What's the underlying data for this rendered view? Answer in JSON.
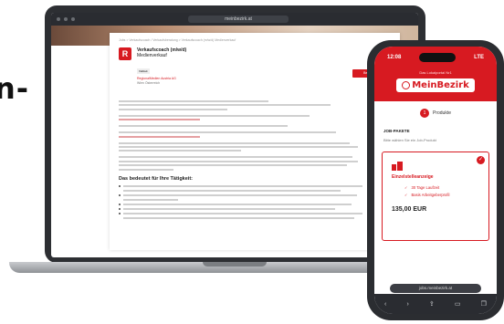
{
  "left_heading": "n-",
  "laptop": {
    "url": "meinbezirk.at",
    "breadcrumb": "Jobs > Verkaufscoach / Verkaufsberatung > Verkaufscoach (m/w/d) Medienverkauf",
    "job_title": "Verkaufscoach (m/w/d)",
    "job_subtitle": "Medienverkauf",
    "job_tag": "Vollzeit",
    "company": "RegionalMedien Austria AG",
    "location": "Wien Österreich",
    "section_heading": "Das bedeutet für Ihre Tätigkeit:",
    "apply_label": "Bewerben"
  },
  "phone": {
    "time": "12:08",
    "signal": "LTE",
    "tagline": "Das Lokalportal Nr1",
    "brand": "MeinBezirk",
    "step_number": "1",
    "step_label": "Produkte",
    "section_title": "JOB-PAKETE",
    "section_sub": "Bitte wählen Sie ein Job-Produkt",
    "product": {
      "name": "Einzelstelleanzeige",
      "features": [
        "30 Tage Laufzeit",
        "Basis Arbeitgeberprofil"
      ],
      "price": "135,00 EUR"
    },
    "address": "jobs.meinbezirk.at"
  },
  "colors": {
    "brand_red": "#d71a21"
  }
}
